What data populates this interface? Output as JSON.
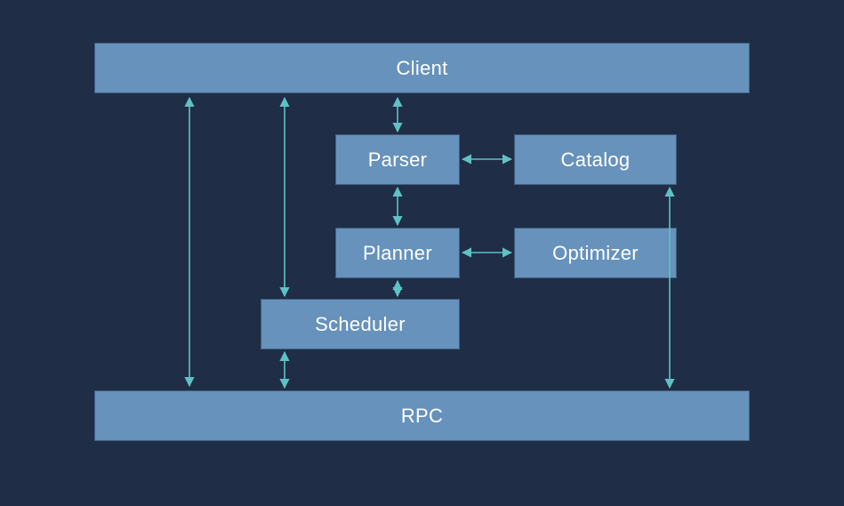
{
  "nodes": {
    "client": {
      "label": "Client"
    },
    "parser": {
      "label": "Parser"
    },
    "catalog": {
      "label": "Catalog"
    },
    "planner": {
      "label": "Planner"
    },
    "optimizer": {
      "label": "Optimizer"
    },
    "scheduler": {
      "label": "Scheduler"
    },
    "rpc": {
      "label": "RPC"
    }
  },
  "edges": [
    {
      "from": "client",
      "to": "parser",
      "bidirectional": true
    },
    {
      "from": "parser",
      "to": "catalog",
      "bidirectional": true
    },
    {
      "from": "parser",
      "to": "planner",
      "bidirectional": true
    },
    {
      "from": "planner",
      "to": "optimizer",
      "bidirectional": true
    },
    {
      "from": "planner",
      "to": "scheduler",
      "bidirectional": true
    },
    {
      "from": "scheduler",
      "to": "rpc",
      "bidirectional": true
    },
    {
      "from": "client",
      "to": "rpc",
      "bidirectional": true,
      "note": "left long connector"
    },
    {
      "from": "client",
      "to": "scheduler",
      "bidirectional": true,
      "note": "second left connector"
    },
    {
      "from": "catalog",
      "to": "rpc",
      "bidirectional": true,
      "note": "right long connector"
    }
  ],
  "colors": {
    "background": "#1f2d46",
    "box_fill": "#6692bb",
    "box_border": "#3c5f7f",
    "arrow": "#5fc1c3",
    "text": "#ffffff"
  }
}
